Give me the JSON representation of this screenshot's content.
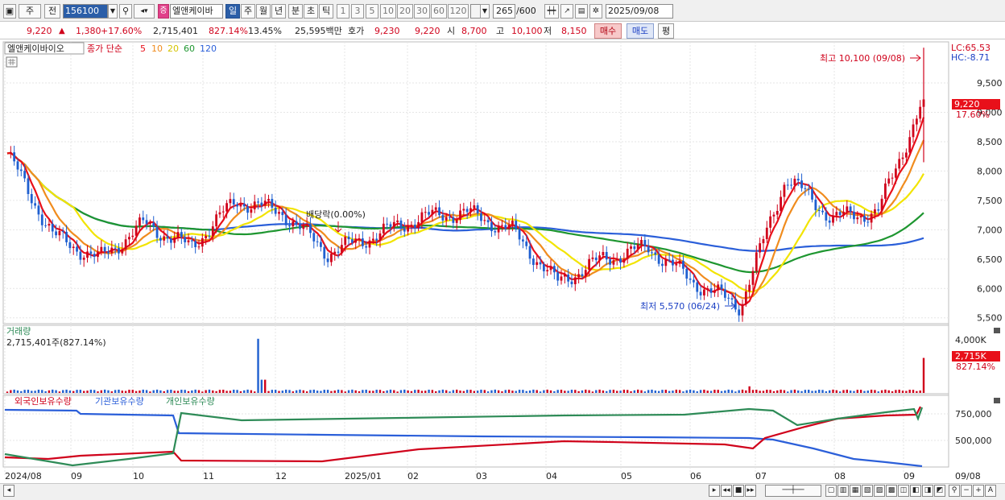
{
  "toolbar": {
    "period_type": "주",
    "prev_label": "전",
    "code": "156100",
    "stock_name": "엘앤케이바",
    "badge": "증",
    "tabs": [
      "일",
      "주",
      "월",
      "년",
      "분",
      "초",
      "틱"
    ],
    "active_tab": "일",
    "intervals": [
      "1",
      "3",
      "5",
      "10",
      "20",
      "30",
      "60",
      "120"
    ],
    "count": "265",
    "count_max": "/600",
    "date": "2025/09/08"
  },
  "quote": {
    "price": "9,220",
    "change": "1,380",
    "change_pct": "+17.60%",
    "volume": "2,715,401",
    "volume_ratio": "827.14%",
    "turnover": "13.45%",
    "amount": "25,595백만",
    "bid_label": "호가",
    "bid": "9,230",
    "ask": "9,220",
    "open_label": "시",
    "open": "8,700",
    "high_label": "고",
    "high": "10,100",
    "low_label": "저",
    "low": "8,150",
    "buy_label": "매수",
    "sell_label": "매도",
    "eval_label": "평"
  },
  "price_panel": {
    "title": "엘앤케이바이오",
    "ma_label": "종가 단순",
    "ma_periods": [
      "5",
      "10",
      "20",
      "60",
      "120"
    ],
    "lc": "LC:65.53",
    "hc": "HC:-8.71",
    "high_note": "최고 10,100 (09/08)",
    "low_note": "최저 5,570 (06/24)",
    "dividend_note": "배당락(0.00%)",
    "price_tag": "9,220",
    "pct_tag": "17.60%",
    "y_ticks": [
      "9,500",
      "9,000",
      "8,500",
      "8,000",
      "7,500",
      "7,000",
      "6,500",
      "6,000",
      "5,500"
    ]
  },
  "volume_panel": {
    "title": "거래량",
    "current": "2,715,401주(827.14%)",
    "y_tick": "4,000K",
    "tag": "2,715K",
    "tag_pct": "827.14%"
  },
  "holdings_panel": {
    "series": [
      "외국인보유수량",
      "기관보유수량",
      "개인보유수량"
    ],
    "y_ticks": [
      "750,000",
      "500,000"
    ]
  },
  "x_axis": [
    "2024/08",
    "09",
    "10",
    "11",
    "12",
    "2025/01",
    "02",
    "03",
    "04",
    "05",
    "06",
    "07",
    "08",
    "09"
  ],
  "x_axis_end": "09/08",
  "colors": {
    "up": "#d0021b",
    "down": "#1f5fd0",
    "ma5": "#e8101a",
    "ma10": "#f08c1e",
    "ma20": "#f2e400",
    "ma60": "#1e9630",
    "ma120": "#2b5fd9",
    "foreign": "#d0021b",
    "institution": "#2b5fd9",
    "individual": "#2e8b57"
  },
  "chart_data": {
    "type": "line",
    "price_range": [
      5400,
      10200
    ],
    "close_series": [
      {
        "date": "2024/08",
        "close": 8300
      },
      {
        "date": "2024/09",
        "close": 6900
      },
      {
        "date": "2024/09b",
        "close": 6500
      },
      {
        "date": "2024/10",
        "close": 7100
      },
      {
        "date": "2024/10b",
        "close": 6700
      },
      {
        "date": "2024/11",
        "close": 7500
      },
      {
        "date": "2024/11b",
        "close": 7300
      },
      {
        "date": "2024/12",
        "close": 6600
      },
      {
        "date": "2024/12b",
        "close": 6900
      },
      {
        "date": "2025/01",
        "close": 7200
      },
      {
        "date": "2025/02",
        "close": 7300
      },
      {
        "date": "2025/03",
        "close": 7000
      },
      {
        "date": "2025/04",
        "close": 6100
      },
      {
        "date": "2025/04b",
        "close": 6500
      },
      {
        "date": "2025/05",
        "close": 6700
      },
      {
        "date": "2025/05b",
        "close": 6100
      },
      {
        "date": "2025/06",
        "close": 5700
      },
      {
        "date": "2025/07",
        "close": 7900
      },
      {
        "date": "2025/08",
        "close": 7200
      },
      {
        "date": "2025/09",
        "close": 7300
      },
      {
        "date": "2025/09/08",
        "close": 9220
      }
    ],
    "high_point": {
      "date": "09/08",
      "value": 10100
    },
    "low_point": {
      "date": "06/24",
      "value": 5570
    }
  }
}
